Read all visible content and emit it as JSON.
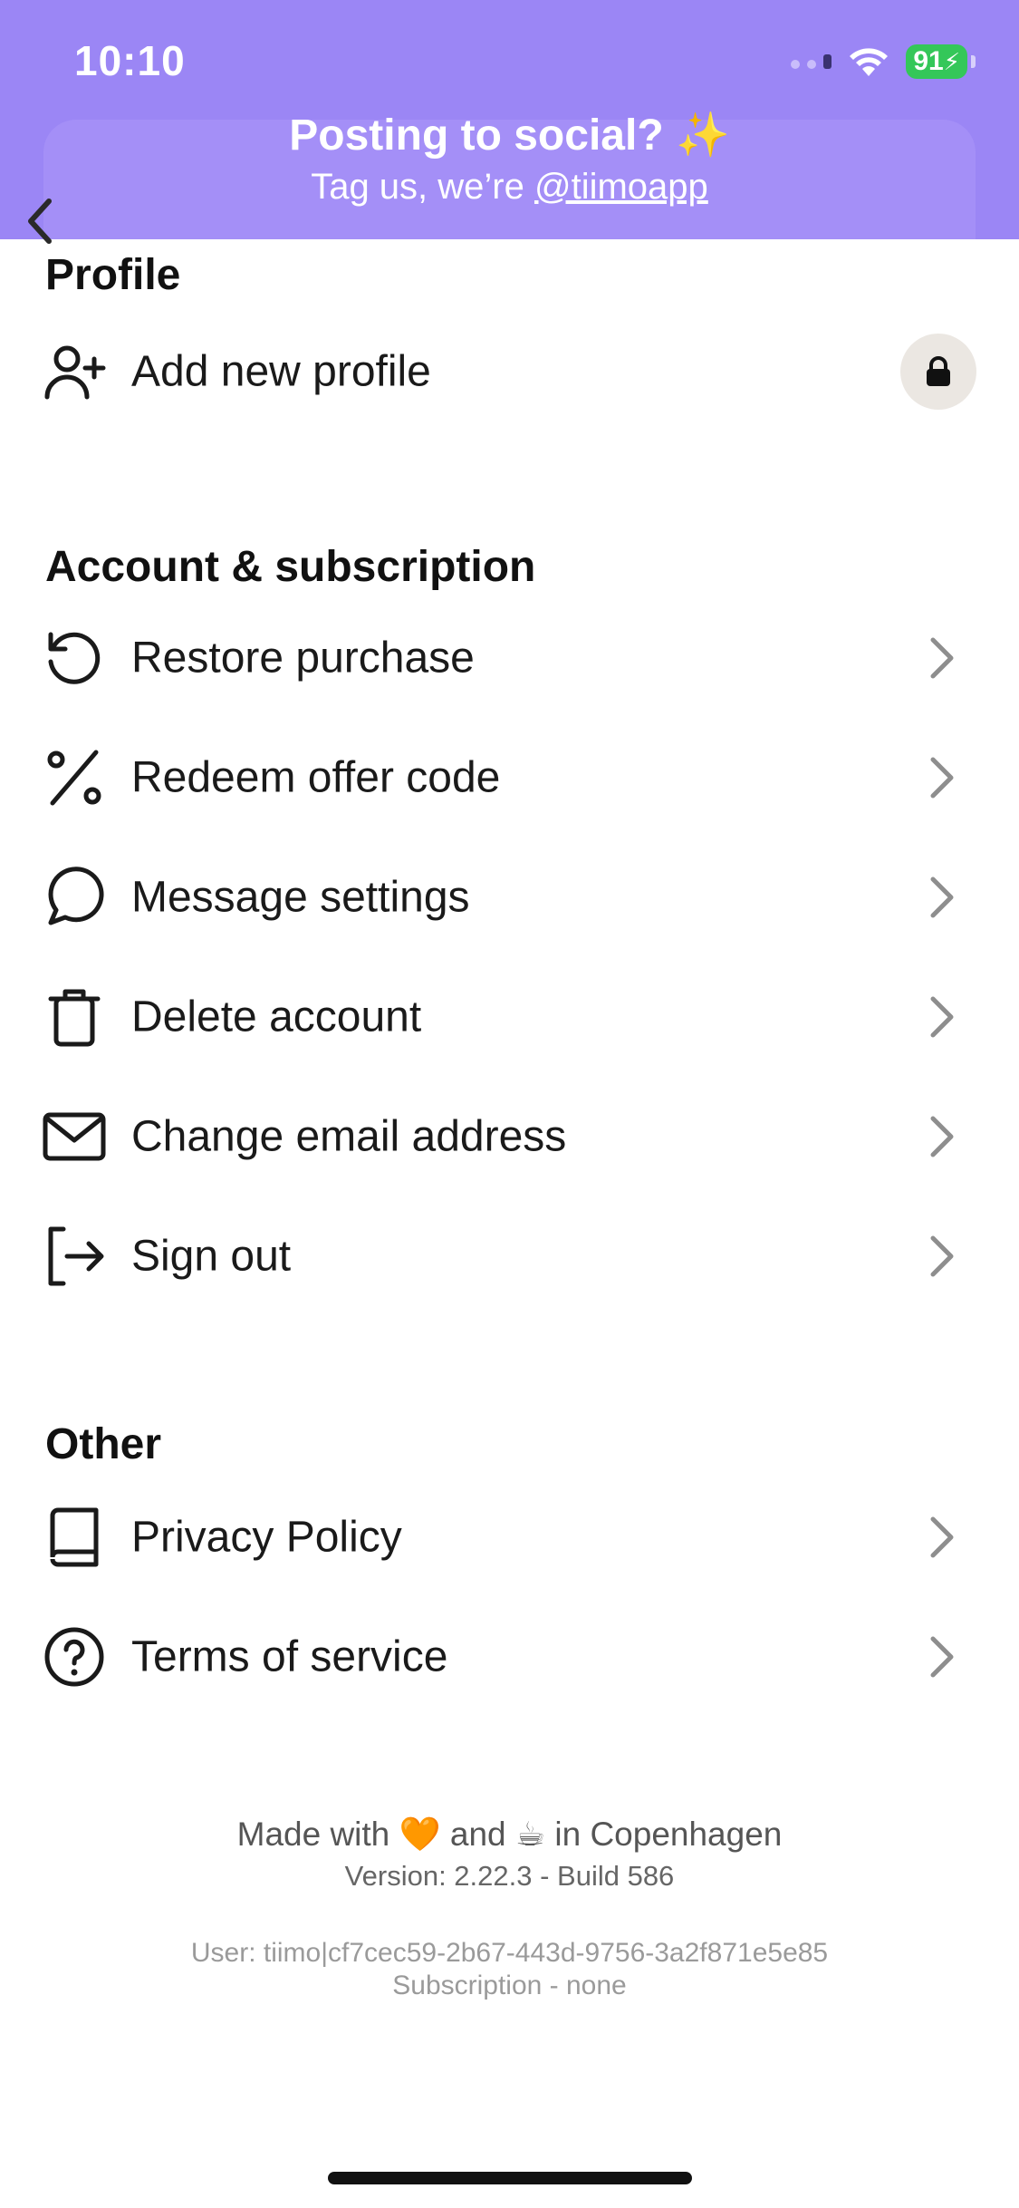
{
  "status_bar": {
    "time": "10:10",
    "battery": "91"
  },
  "banner": {
    "title": "Posting to social? ✨",
    "subtitle_prefix": "Tag us, we’re ",
    "handle": "@tiimoapp",
    "background": "#9b86f5"
  },
  "sections": {
    "profile": {
      "title": "Profile",
      "add_profile": {
        "label": "Add new profile",
        "icon": "add-user-icon",
        "locked": true
      }
    },
    "account": {
      "title": "Account & subscription",
      "items": [
        {
          "label": "Restore purchase",
          "icon": "restore-icon"
        },
        {
          "label": "Redeem offer code",
          "icon": "percent-icon"
        },
        {
          "label": "Message settings",
          "icon": "chat-bubble-icon"
        },
        {
          "label": "Delete account",
          "icon": "trash-icon"
        },
        {
          "label": "Change email address",
          "icon": "mail-icon"
        },
        {
          "label": "Sign out",
          "icon": "sign-out-icon"
        }
      ]
    },
    "other": {
      "title": "Other",
      "items": [
        {
          "label": "Privacy Policy",
          "icon": "book-icon"
        },
        {
          "label": "Terms of service",
          "icon": "question-circle-icon"
        }
      ]
    }
  },
  "footer": {
    "made_prefix": "Made with ",
    "heart": "🧡",
    "made_and": " and ",
    "coffee": "☕",
    "made_suffix": " in Copenhagen",
    "version": "Version: 2.22.3 - Build 586",
    "user": "User: tiimo|cf7cec59-2b67-443d-9756-3a2f871e5e85",
    "subscription": "Subscription - none"
  }
}
